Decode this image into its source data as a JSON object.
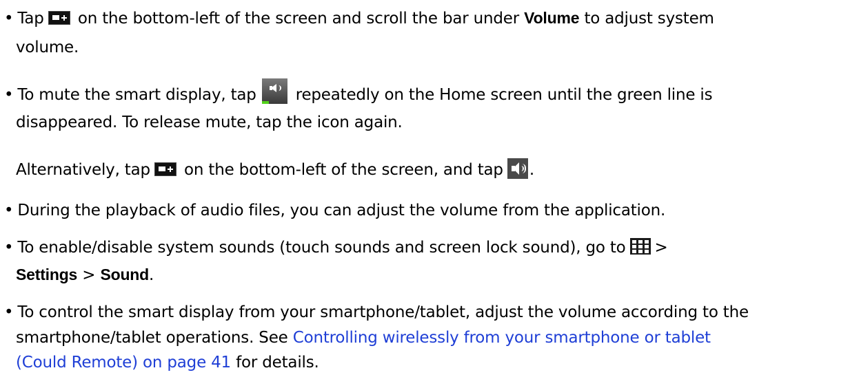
{
  "bullet": "•",
  "icons": {
    "menu": "expand-menu-icon",
    "speaker": "speaker-mute-icon",
    "volume": "volume-icon",
    "apps": "apps-grid-icon"
  },
  "colors": {
    "link": "#1f3fd6",
    "mute_indicator": "#52d11a"
  },
  "items": {
    "volume_bar": {
      "a": "Tap",
      "b": "on the bottom-left of the screen and scroll the bar under",
      "bold": "Volume",
      "c": "to adjust system",
      "d": "volume."
    },
    "mute": {
      "a": "To mute the smart display, tap",
      "b": "repeatedly on the Home screen until the green line is",
      "c": "disappeared. To release mute, tap the icon again.",
      "alt_a": "Alternatively, tap",
      "alt_b": "on the bottom-left of the screen, and tap",
      "alt_c": "."
    },
    "playback": {
      "a": "During the playback of audio files, you can adjust the volume from the application."
    },
    "system_sounds": {
      "a": "To enable/disable system sounds (touch sounds and screen lock sound), go to",
      "b": ">",
      "settings": "Settings",
      "sep": ">",
      "sound": "Sound",
      "end": "."
    },
    "remote": {
      "a": "To control the smart display from your smartphone/tablet, adjust the volume according to the",
      "b": "smartphone/tablet operations. See",
      "link1": "Controlling wirelessly from your smartphone or tablet",
      "link2": "(Could Remote) on page 41",
      "c": "for details."
    }
  }
}
